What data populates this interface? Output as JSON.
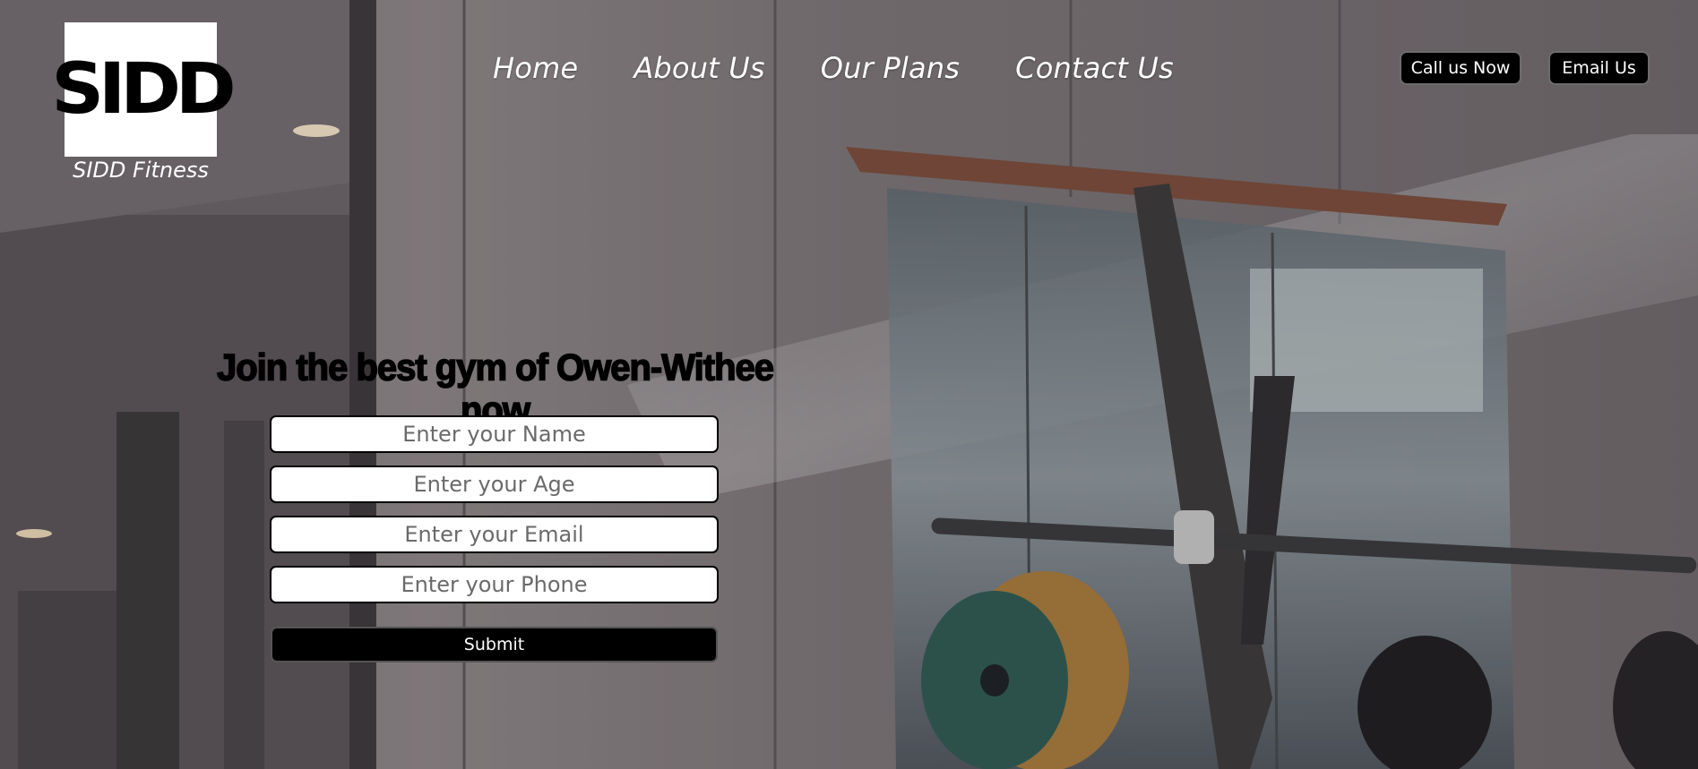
{
  "brand": {
    "logo_text": "SIDD",
    "name": "SIDD Fitness"
  },
  "nav": {
    "items": [
      {
        "label": "Home"
      },
      {
        "label": "About Us"
      },
      {
        "label": "Our Plans"
      },
      {
        "label": "Contact Us"
      }
    ]
  },
  "contact": {
    "call_label": "Call us Now",
    "email_label": "Email Us"
  },
  "hero": {
    "headline": "Join the best gym of Owen-Withee now"
  },
  "form": {
    "name_placeholder": "Enter your Name",
    "age_placeholder": "Enter your Age",
    "email_placeholder": "Enter your Email",
    "phone_placeholder": "Enter your Phone",
    "submit_label": "Submit"
  },
  "colors": {
    "button_bg": "#000000",
    "text_light": "#ffffff"
  }
}
